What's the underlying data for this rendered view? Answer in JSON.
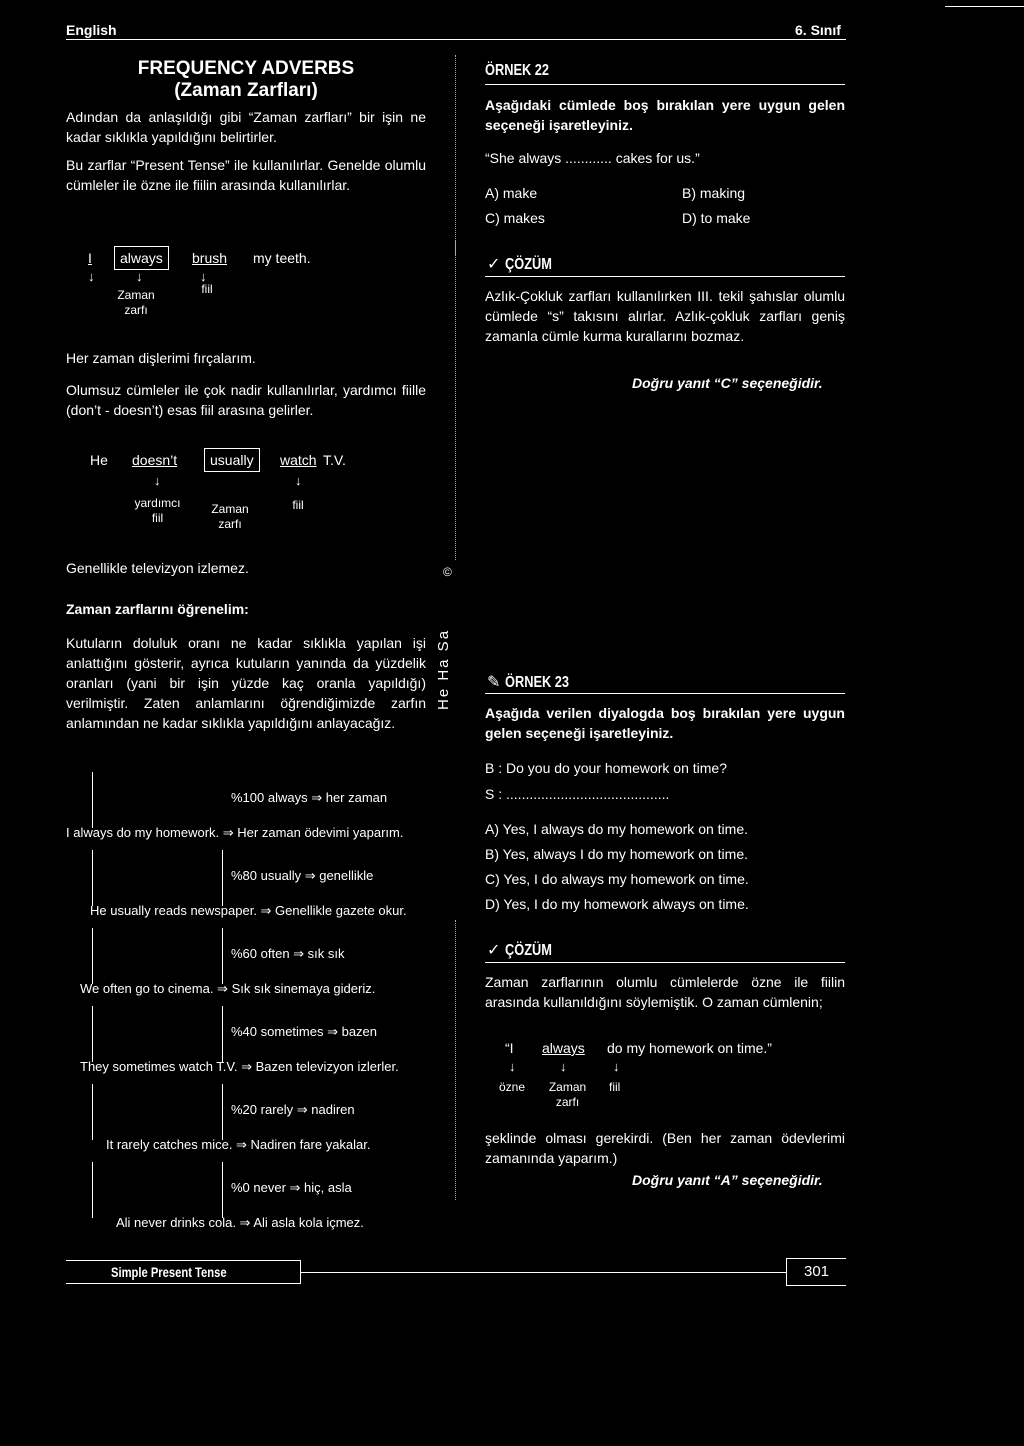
{
  "header": {
    "subject": "English",
    "grade": "6. Sınıf"
  },
  "left": {
    "title": "FREQUENCY ADVERBS",
    "subtitle": "(Zaman Zarfları)",
    "intro1": "Adından da anlaşıldığı gibi “Zaman zarfları” bir işin ne kadar sıklıkla yapıldığını belirtirler.",
    "intro2": "Bu zarflar “Present Tense” ile kullanılırlar. Genelde olumlu cümleler ile özne ile fiilin arasında kullanılırlar.",
    "ex1": {
      "w1": "I",
      "w2": "always",
      "w3": "brush",
      "w4": "my teeth.",
      "l2": "Zaman zarfı",
      "l3": "fiil",
      "translation": "Her zaman dişlerimi fırçalarım."
    },
    "neg_text": "Olumsuz cümleler ile çok nadir kullanılırlar, yardımcı fiille (don’t - doesn’t) esas fiil arasına gelirler.",
    "ex2": {
      "w1": "He",
      "w2": "doesn’t",
      "w3": "usually",
      "w4": "watch",
      "w5": "T.V.",
      "l2": "yardımcı fiil",
      "l3": "Zaman zarfı",
      "l4": "fiil",
      "translation": "Genellikle televizyon izlemez."
    },
    "learn_title": "Zaman zarflarını öğrenelim:",
    "learn_text": "Kutuların doluluk oranı ne kadar sıklıkla yapılan işi anlattığını gösterir, ayrıca kutuların yanında da yüzdelik oranları (yani bir işin yüzde kaç oranla yapıldığı) verilmiştir. Zaten anlamlarını öğrendiğimizde zarfın anlamından ne kadar sıklıkla yapıldığını anlayacağız.",
    "freq": [
      {
        "label": "%100 always ⇒ her zaman",
        "example": "I always do my homework. ⇒ Her zaman ödevimi yaparım.",
        "level": 100
      },
      {
        "label": "%80 usually ⇒ genellikle",
        "example": "He usually reads newspaper. ⇒ Genellikle gazete okur.",
        "level": 80
      },
      {
        "label": "%60 often ⇒ sık sık",
        "example": "We often go to cinema. ⇒ Sık sık sinemaya gideriz.",
        "level": 60
      },
      {
        "label": "%40 sometimes ⇒ bazen",
        "example": "They sometimes watch T.V. ⇒ Bazen televizyon izlerler.",
        "level": 40
      },
      {
        "label": "%20 rarely ⇒ nadiren",
        "example": "It rarely catches mice. ⇒ Nadiren fare yakalar.",
        "level": 20
      },
      {
        "label": "%0 never ⇒ hiç, asla",
        "example": "Ali never drinks cola. ⇒ Ali asla kola içmez.",
        "level": 0
      }
    ]
  },
  "margin_text": "He Ha Sa",
  "copyright": "©",
  "right": {
    "ex22": {
      "title": "ÖRNEK 22",
      "question": "Aşağıdaki cümlede boş bırakılan yere uygun gelen seçeneği işaretleyiniz.",
      "sentence": "“She always ............ cakes for us.”",
      "a": "A) make",
      "b": "B) making",
      "c": "C) makes",
      "d": "D) to make"
    },
    "sol22": {
      "title": "ÇÖZÜM",
      "text": "Azlık-Çokluk zarfları kullanılırken III. tekil şahıslar olumlu cümlede “s” takısını alırlar. Azlık-çokluk zarfları geniş zamanla cümle kurma kurallarını bozmaz.",
      "answer": "Doğru yanıt “C” seçeneğidir."
    },
    "ex23": {
      "title": "ÖRNEK 23",
      "question": "Aşağıda verilen diyalogda boş bırakılan yere uygun gelen seçeneği işaretleyiniz.",
      "b_line": "B :  Do you do your homework on time?",
      "s_line": "S :  ..........................................",
      "a": "A) Yes, I always do my homework on time.",
      "b": "B) Yes, always I do my homework on time.",
      "c": "C) Yes, I do always my homework on time.",
      "d": "D) Yes, I do my homework always on time."
    },
    "sol23": {
      "title": "ÇÖZÜM",
      "text": "Zaman zarflarının olumlu cümlelerde özne ile fiilin arasında kullanıldığını söylemiştik. O zaman cümlenin;",
      "w1": "“I",
      "w2": "always",
      "w3": "do my homework on time.”",
      "l1": "özne",
      "l2": "Zaman zarfı",
      "l3": "fiil",
      "text2": "şeklinde olması gerekirdi. (Ben her zaman ödevlerimi zamanında yaparım.)",
      "answer": "Doğru yanıt “A” seçeneğidir."
    }
  },
  "footer": {
    "section": "Simple Present Tense",
    "page": "301"
  }
}
